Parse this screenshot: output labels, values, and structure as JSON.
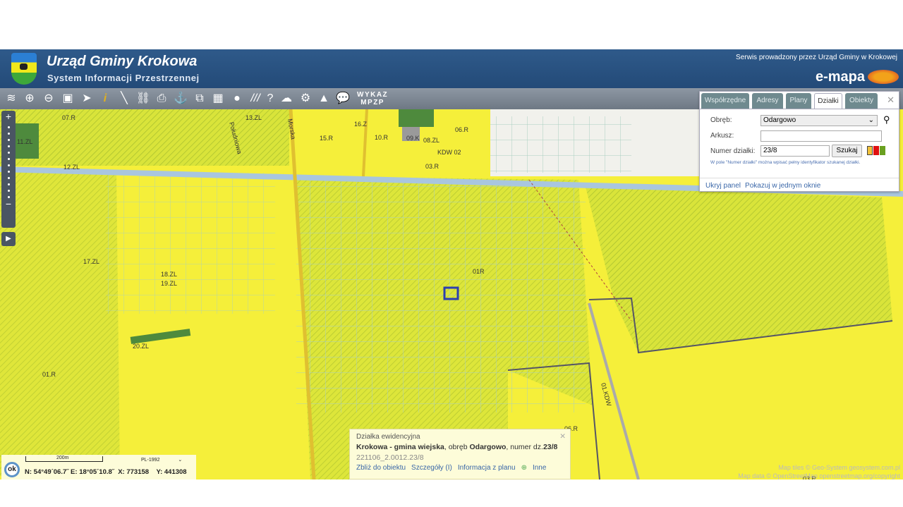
{
  "header": {
    "title": "Urząd Gminy Krokowa",
    "subtitle": "System Informacji Przestrzennej",
    "service": "Serwis prowadzony przez Urząd Gminy w Krokowej",
    "brand": "e-mapa"
  },
  "toolbar": {
    "tools": [
      "layers-icon",
      "zoom-in-icon",
      "zoom-out-icon",
      "full-extent-icon",
      "select-arrow-icon",
      "info-icon",
      "measure-line-icon",
      "link-icon",
      "print-icon",
      "street-view-icon",
      "overlay-icon",
      "layout-icon",
      "comment-icon",
      "hatch-icon",
      "help-icon",
      "cloud-download-icon",
      "settings-icon",
      "warning-icon",
      "user-chat-icon"
    ],
    "wykaz_line1": "WYKAZ",
    "wykaz_line2": "MPZP"
  },
  "map": {
    "labels": [
      "07.R",
      "13.ZL",
      "11.ZL",
      "12.ZL",
      "Południowa",
      "Morska",
      "15.R",
      "16.Z",
      "10.R",
      "09.K",
      "08.ZL",
      "06.R",
      "KDW 02",
      "03.R",
      "01R",
      "17.ZL",
      "18.ZL",
      "19.ZL",
      "20.ZL",
      "01.R",
      "01.KDW",
      "06.R",
      "03.R"
    ],
    "colors": {
      "yellow": "#f5ef3a",
      "green_forest": "#c5db3a",
      "dark_green": "#4e8a3d",
      "selected": "#2b3fb0"
    }
  },
  "search_panel": {
    "tabs": [
      "Współrzędne",
      "Adresy",
      "Plany",
      "Działki",
      "Obiekty"
    ],
    "active_tab": "Działki",
    "obreb_label": "Obręb:",
    "obreb_value": "Odargowo",
    "arkusz_label": "Arkusz:",
    "arkusz_value": "",
    "numer_label": "Numer działki:",
    "numer_value": "23/8",
    "search_button": "Szukaj",
    "hint": "W pole \"Numer działki\" można wpisać pełny identyfikator szukanej działki.",
    "hide_link": "Ukryj panel",
    "single_window_link": "Pokazuj w jednym oknie",
    "swatches": [
      "#f2c23a",
      "#e01010",
      "#6aa020"
    ]
  },
  "popup": {
    "title": "Działka ewidencyjna",
    "gmina": "Krokowa - gmina wiejska",
    "obreb_prefix": ", obręb ",
    "obreb": "Odargowo",
    "numer_prefix": ", numer dz.",
    "numer": "23/8",
    "identifier": "221106_2.0012.23/8",
    "links": [
      "Zbliż do obiektu",
      "Szczegóły (I)",
      "Informacja z planu",
      "Inne"
    ]
  },
  "status": {
    "ok": "ok",
    "scale": "200m",
    "crs": "PL-1992",
    "coords": "N: 54°49´06.7˝ E: 18°05´10.8˝  X: 773158    Y: 441308"
  },
  "attribution": {
    "line1": "Map tiles © Geo-System geosystem.com.pl",
    "line2": "Map data © OpenStreetMap openstreetmap.org/copyright"
  }
}
